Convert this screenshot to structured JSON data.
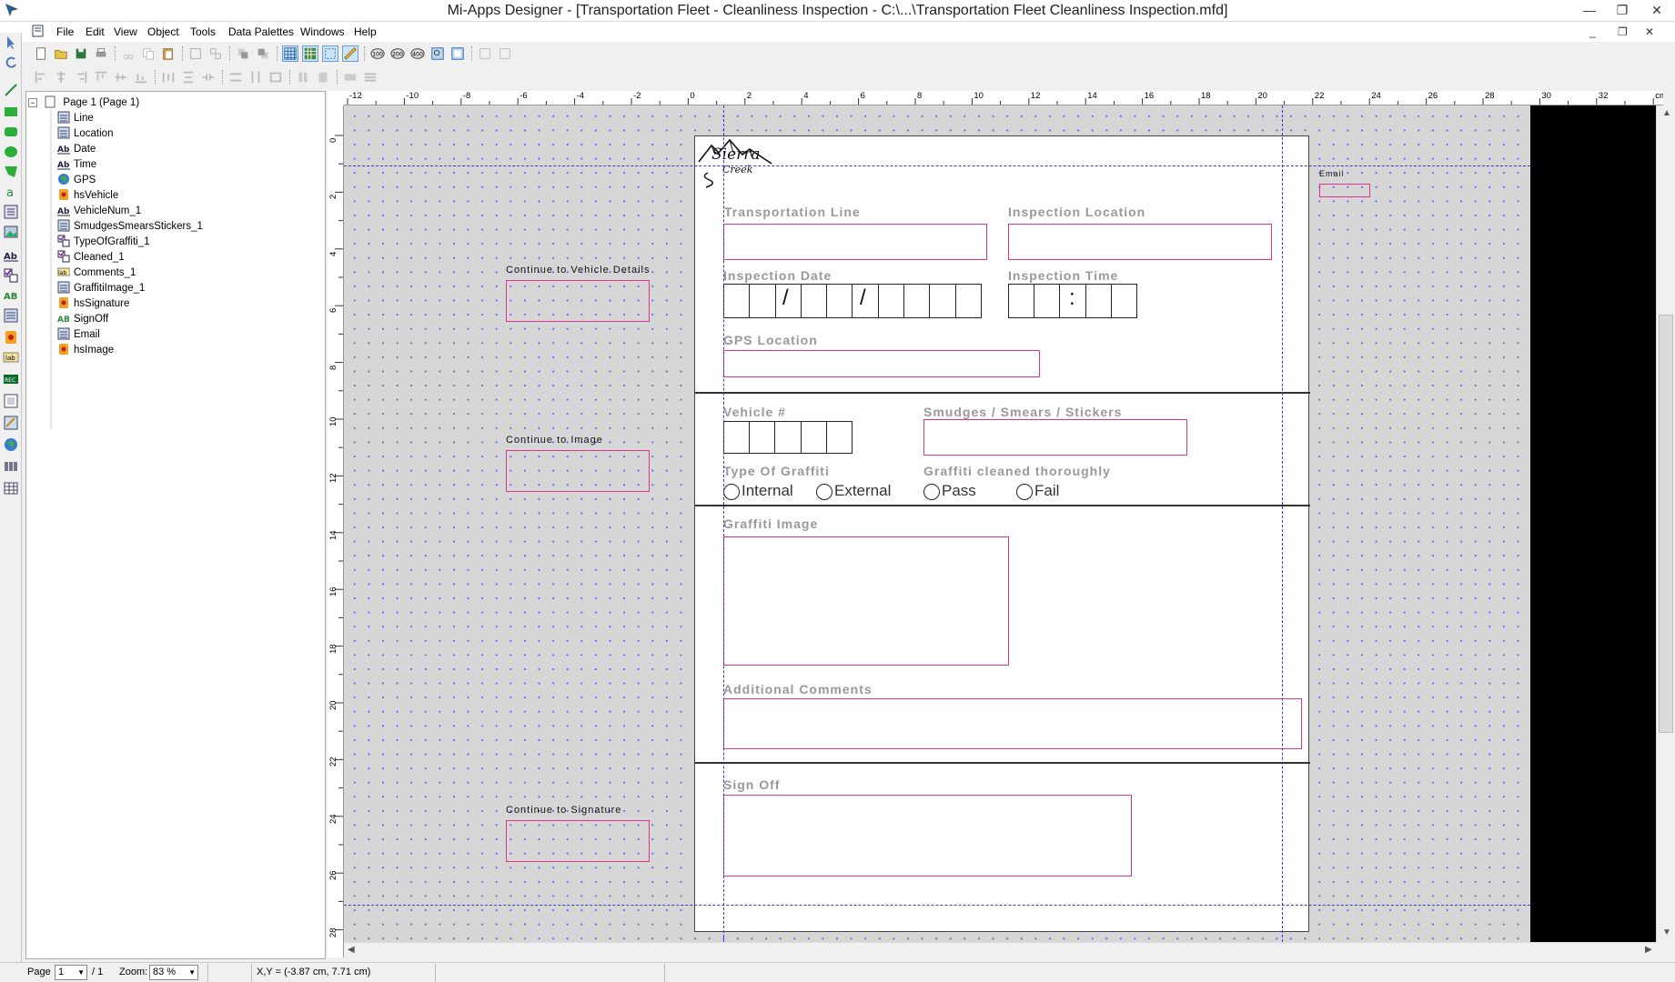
{
  "window": {
    "title": "Mi-Apps Designer - [Transportation Fleet - Cleanliness Inspection - C:\\...\\Transportation Fleet Cleanliness Inspection.mfd]"
  },
  "menu": [
    "File",
    "Edit",
    "View",
    "Object",
    "Tools",
    "Data Palettes",
    "Windows",
    "Help"
  ],
  "tree": {
    "root": "Page 1 (Page 1)",
    "items": [
      {
        "label": "Line",
        "icon": "field-icon"
      },
      {
        "label": "Location",
        "icon": "field-icon"
      },
      {
        "label": "Date",
        "icon": "text-icon"
      },
      {
        "label": "Time",
        "icon": "text-icon"
      },
      {
        "label": "GPS",
        "icon": "globe-icon"
      },
      {
        "label": "hsVehicle",
        "icon": "hotspot-icon"
      },
      {
        "label": "VehicleNum_1",
        "icon": "text-icon"
      },
      {
        "label": "SmudgesSmearsStickers_1",
        "icon": "field-icon"
      },
      {
        "label": "TypeOfGraffiti_1",
        "icon": "checkbox-icon"
      },
      {
        "label": "Cleaned_1",
        "icon": "checkbox-icon"
      },
      {
        "label": "Comments_1",
        "icon": "label-icon"
      },
      {
        "label": "GraffitiImage_1",
        "icon": "field-icon"
      },
      {
        "label": "hsSignature",
        "icon": "hotspot-icon"
      },
      {
        "label": "SignOff",
        "icon": "signature-icon"
      },
      {
        "label": "Email",
        "icon": "field-icon"
      },
      {
        "label": "hsImage",
        "icon": "hotspot-icon"
      }
    ]
  },
  "ruler": {
    "h_labels": [
      "-12",
      "-10",
      "-8",
      "-6",
      "-4",
      "-2",
      "0",
      "2",
      "4",
      "6",
      "8",
      "10",
      "12",
      "14",
      "16",
      "18",
      "20",
      "22",
      "24",
      "26",
      "28",
      "30",
      "32",
      "cm"
    ],
    "v_labels": [
      "0",
      "2",
      "4",
      "6",
      "8",
      "10",
      "12",
      "14",
      "16",
      "18",
      "20",
      "22",
      "24",
      "26",
      "28",
      "cm"
    ]
  },
  "form": {
    "logo_line1": "Sierra",
    "logo_line2": "Creek",
    "transportation_line": "Transportation Line",
    "inspection_location": "Inspection Location",
    "inspection_date": "Inspection Date",
    "inspection_time": "Inspection Time",
    "date_sep": "/",
    "time_sep": ":",
    "gps_location": "GPS Location",
    "vehicle_num": "Vehicle #",
    "smudges": "Smudges / Smears / Stickers",
    "type_of_graffiti": "Type Of Graffiti",
    "graffiti_cleaned": "Graffiti cleaned thoroughly",
    "radio_internal": "Internal",
    "radio_external": "External",
    "radio_pass": "Pass",
    "radio_fail": "Fail",
    "graffiti_image": "Graffiti Image",
    "additional_comments": "Additional Comments",
    "sign_off": "Sign Off"
  },
  "side": {
    "continue_vehicle": "Continue to Vehicle Details",
    "continue_image": "Continue to Image",
    "continue_signature": "Continue to Signature",
    "email": "Email"
  },
  "status": {
    "page_label": "Page",
    "page_value": "1",
    "page_total": "/ 1",
    "zoom_label": "Zoom:",
    "zoom_value": "83 %",
    "coords": "X,Y = (-3.87 cm, 7.71 cm)"
  },
  "colors": {
    "field_border": "#e0338c",
    "guide": "#3a3ac8",
    "canvas_bg": "#d6d6d6"
  }
}
